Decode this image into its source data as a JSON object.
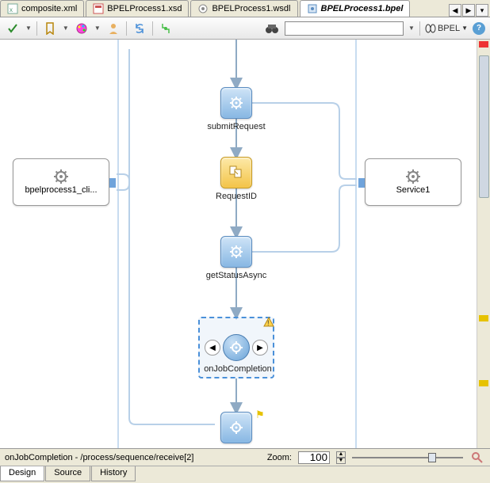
{
  "tabs": [
    {
      "label": "composite.xml",
      "icon": "xml"
    },
    {
      "label": "BPELProcess1.xsd",
      "icon": "xsd"
    },
    {
      "label": "BPELProcess1.wsdl",
      "icon": "wsdl"
    },
    {
      "label": "BPELProcess1.bpel",
      "icon": "bpel",
      "active": true
    }
  ],
  "toolbar": {
    "bpel_label": "BPEL"
  },
  "partners": {
    "left": {
      "label": "bpelprocess1_cli..."
    },
    "right": {
      "label": "Service1"
    }
  },
  "activities": {
    "submitRequest": "submitRequest",
    "requestId": "RequestID",
    "getStatusAsync": "getStatusAsync",
    "onJobCompletion": "onJobCompletion"
  },
  "status": {
    "path": "onJobCompletion - /process/sequence/receive[2]",
    "zoom_label": "Zoom:",
    "zoom_value": "100"
  },
  "bottom_tabs": [
    "Design",
    "Source",
    "History"
  ],
  "colors": {
    "accent": "#6fa3db",
    "warn": "#f3c448"
  }
}
